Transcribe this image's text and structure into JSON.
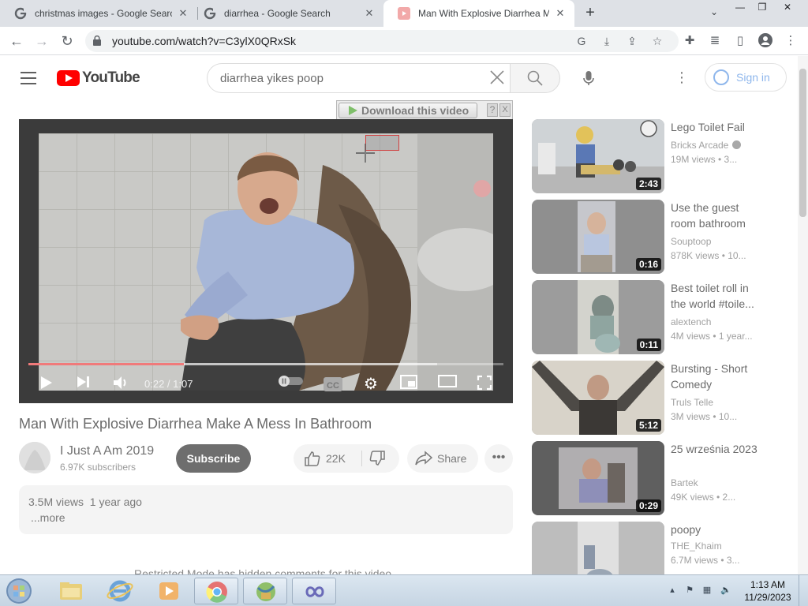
{
  "browser": {
    "tabs": [
      {
        "title": "christmas images - Google Search",
        "favicon": "google-icon",
        "active": false
      },
      {
        "title": "diarrhea - Google Search",
        "favicon": "google-icon",
        "active": false
      },
      {
        "title": "Man With Explosive Diarrhea Make A Mess In Bathroom",
        "favicon": "youtube-icon",
        "active": true
      }
    ],
    "new_tab_label": "+",
    "url": "youtube.com/watch?v=C3ylX0QRxSk",
    "window_controls": {
      "minimize": "—",
      "restore": "❐",
      "close": "✕"
    }
  },
  "youtube": {
    "logo_text": "YouTube",
    "search_query": "diarrhea yikes poop",
    "sign_in_label": "Sign in",
    "download_bar": {
      "button_label": "Download this video",
      "help": "?",
      "close": "X"
    },
    "player": {
      "current_time": "0:22",
      "duration": "1:07",
      "time_display": "0:22 / 1:07",
      "played_fraction": 0.328,
      "loaded_fraction": 0.86,
      "cc_label": "CC"
    },
    "video": {
      "title": "Man With Explosive Diarrhea Make A Mess In Bathroom",
      "channel": "I Just A Am 2019",
      "subscribers": "6.97K subscribers",
      "subscribe_label": "Subscribe",
      "likes": "22K",
      "share_label": "Share",
      "views": "3.5M views",
      "age": "1 year ago",
      "meta_line": "3.5M views  1 year ago",
      "more_label": "...more",
      "restricted_note": "Restricted Mode has hidden comments for this video."
    },
    "recommendations": [
      {
        "title": "Lego Toilet Fail",
        "channel": "Bricks Arcade",
        "verified": true,
        "stats": "19M views  •  3...",
        "duration": "2:43"
      },
      {
        "title": "Use the guest room bathroom",
        "channel": "Souptoop",
        "verified": false,
        "stats": "878K views  •  10...",
        "duration": "0:16"
      },
      {
        "title": "Best toilet roll in the world #toile...",
        "channel": "alextench",
        "verified": false,
        "stats": "4M views  •  1 year...",
        "duration": "0:11"
      },
      {
        "title": "Bursting - Short Comedy",
        "channel": "Truls Telle",
        "verified": false,
        "stats": "3M views  •  10...",
        "duration": "5:12"
      },
      {
        "title": "25 września 2023",
        "channel": "Bartek",
        "verified": false,
        "stats": "49K views  •  2...",
        "duration": "0:29"
      },
      {
        "title": "poopy",
        "channel": "THE_Khaim",
        "verified": false,
        "stats": "6.7M views  •  3...",
        "duration": ""
      }
    ]
  },
  "taskbar": {
    "apps": [
      "explorer-icon",
      "internet-explorer-icon",
      "media-player-icon",
      "chrome-icon",
      "app-icon",
      "infinity-app-icon"
    ],
    "clock_time": "1:13 AM",
    "clock_date": "11/29/2023"
  },
  "colors": {
    "youtube_red": "#ff0000",
    "progress_red": "#f07a7a",
    "sign_in_blue": "#8fb7ec"
  }
}
